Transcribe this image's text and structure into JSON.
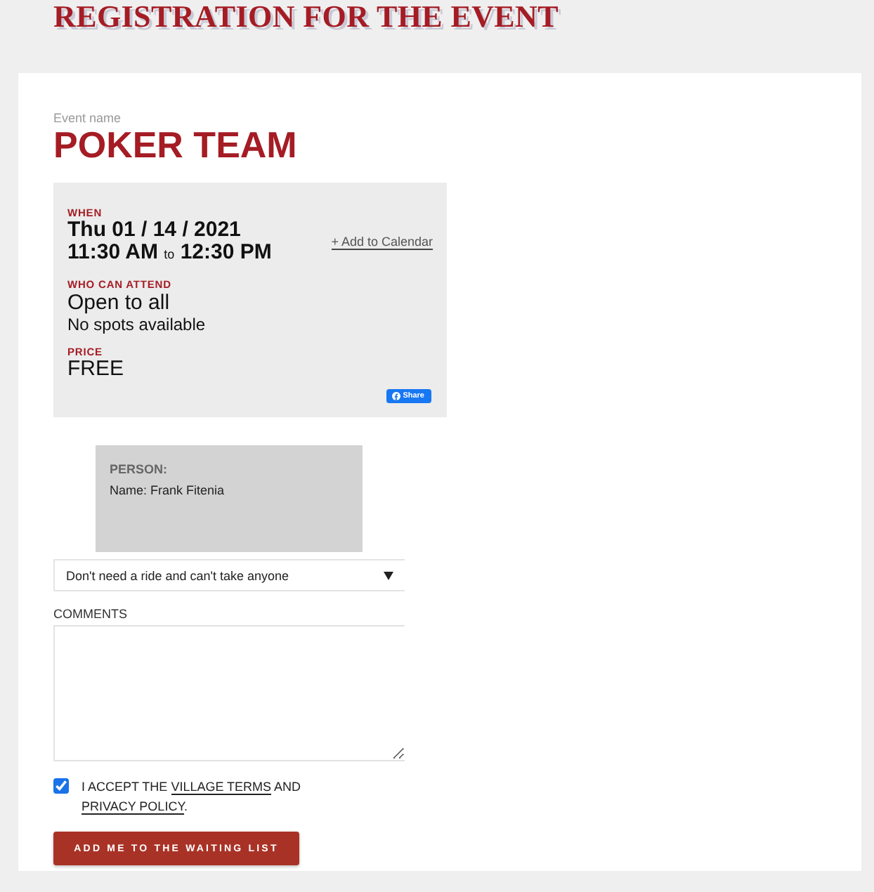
{
  "page_title": "REGISTRATION FOR THE EVENT",
  "event": {
    "label": "Event name",
    "name": "POKER TEAM"
  },
  "details": {
    "when_label": "WHEN",
    "date": "Thu 01 / 14 / 2021",
    "start_time": "11:30 AM",
    "time_separator": "to",
    "end_time": "12:30 PM",
    "add_to_calendar": "+ Add to Calendar",
    "attend_label": "WHO CAN ATTEND",
    "attendance": "Open to all",
    "availability": "No spots available",
    "price_label": "PRICE",
    "price": "FREE",
    "share_button": "Share"
  },
  "person": {
    "heading": "PERSON:",
    "name": "Name: Frank Fitenia"
  },
  "ride_select": {
    "value": "Don't need a ride and can't take anyone"
  },
  "comments": {
    "label": "COMMENTS"
  },
  "terms": {
    "checked": true,
    "parts": [
      {
        "kind": "text",
        "text": "I ACCEPT THE "
      },
      {
        "kind": "link",
        "text": "VILLAGE TERMS"
      },
      {
        "kind": "text",
        "text": " AND "
      },
      {
        "kind": "link",
        "text": "PRIVACY POLICY"
      },
      {
        "kind": "text",
        "text": "."
      }
    ]
  },
  "submit_button": "ADD ME TO THE WAITING LIST"
}
